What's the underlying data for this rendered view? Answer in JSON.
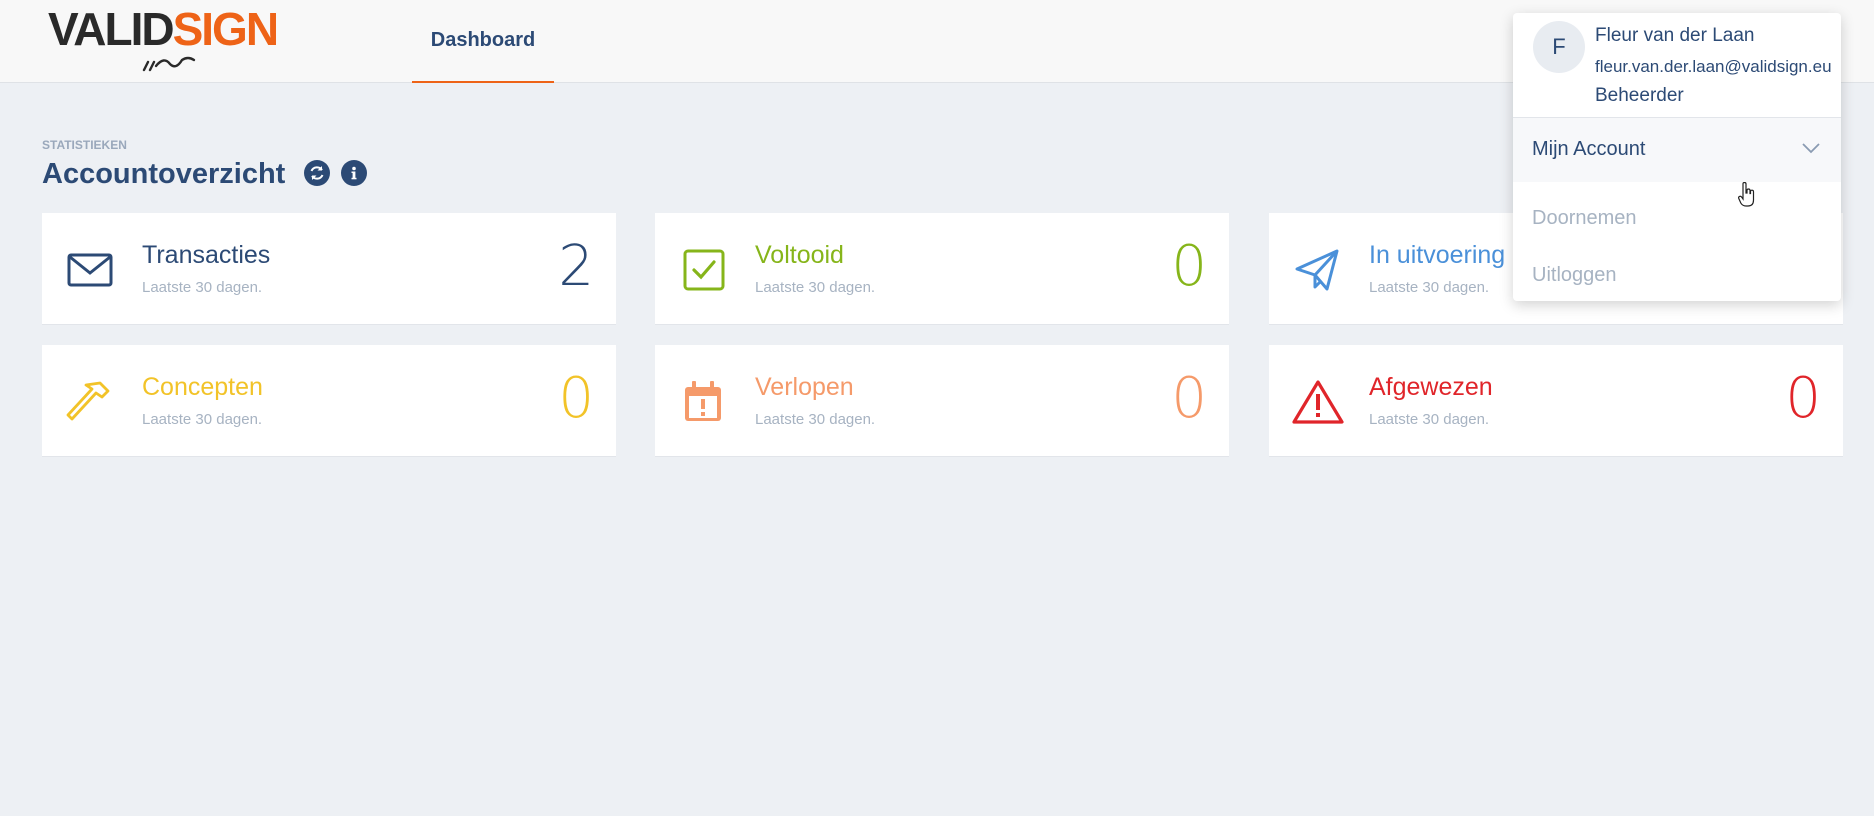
{
  "header": {
    "logo_primary": "VALID",
    "logo_accent": "SIGN",
    "nav_tab": "Dashboard"
  },
  "section": {
    "kicker": "STATISTIEKEN",
    "title": "Accountoverzicht",
    "refresh_icon": "refresh-icon",
    "info_icon": "info-icon"
  },
  "cards": [
    {
      "title": "Transacties",
      "subtitle": "Laatste 30 dagen.",
      "count": "2",
      "color": "#2c4a75",
      "icon": "envelope-icon"
    },
    {
      "title": "Voltooid",
      "subtitle": "Laatste 30 dagen.",
      "count": "0",
      "color": "#86b51a",
      "icon": "checkbox-icon"
    },
    {
      "title": "In uitvoering",
      "subtitle": "Laatste 30 dagen.",
      "count": "",
      "color": "#4a90d9",
      "icon": "paper-plane-icon"
    },
    {
      "title": "Concepten",
      "subtitle": "Laatste 30 dagen.",
      "count": "0",
      "color": "#f2c328",
      "icon": "hammer-icon"
    },
    {
      "title": "Verlopen",
      "subtitle": "Laatste 30 dagen.",
      "count": "0",
      "color": "#f59a6a",
      "icon": "calendar-alert-icon"
    },
    {
      "title": "Afgewezen",
      "subtitle": "Laatste 30 dagen.",
      "count": "0",
      "color": "#e0252a",
      "icon": "warning-triangle-icon"
    }
  ],
  "user_menu": {
    "avatar_initial": "F",
    "name": "Fleur van der Laan",
    "email": "fleur.van.der.laan@validsign.eu",
    "role": "Beheerder",
    "account_label": "Mijn Account",
    "items": [
      "Doornemen",
      "Uitloggen"
    ]
  }
}
